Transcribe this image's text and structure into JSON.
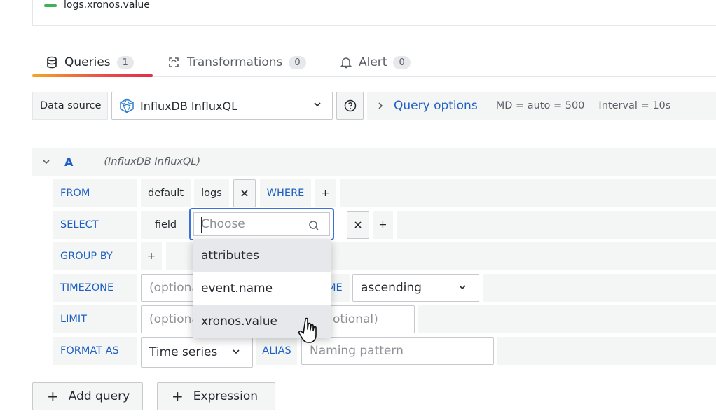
{
  "legend": {
    "label": "logs.xronos.value",
    "color": "#3eb15b"
  },
  "tabs": [
    {
      "label": "Queries",
      "count": "1",
      "icon": "database-icon"
    },
    {
      "label": "Transformations",
      "count": "0",
      "icon": "transform-icon"
    },
    {
      "label": "Alert",
      "count": "0",
      "icon": "bell-icon"
    }
  ],
  "datasource": {
    "label": "Data source",
    "selected": "InfluxDB InfluxQL",
    "query_options_label": "Query options",
    "md": "MD = auto = 500",
    "interval": "Interval = 10s"
  },
  "query": {
    "name": "A",
    "source": "(InfluxDB InfluxQL)"
  },
  "rows": {
    "from": {
      "label": "FROM",
      "policy": "default",
      "measurement": "logs",
      "where": "WHERE",
      "plus": "+",
      "remove": "×"
    },
    "select": {
      "label": "SELECT",
      "field": "field",
      "plus": "+",
      "remove": "×"
    },
    "groupby": {
      "label": "GROUP BY",
      "plus": "+"
    },
    "timezone": {
      "label": "TIMEZONE",
      "placeholder": "(optiona",
      "order_label_partial": "ME",
      "order_value": "ascending"
    },
    "limit": {
      "label": "LIMIT",
      "placeholder": "(optiona",
      "slimit_placeholder": "otional)"
    },
    "format": {
      "label": "FORMAT AS",
      "value": "Time series",
      "alias_label": "ALIAS",
      "alias_placeholder": "Naming pattern"
    }
  },
  "field_picker": {
    "placeholder": "Choose",
    "options": [
      "attributes",
      "event.name",
      "xronos.value"
    ]
  },
  "buttons": {
    "add_query": "Add query",
    "expression": "Expression"
  },
  "colors": {
    "accent_blue": "#1f60c4",
    "focus_blue": "#3d71d9"
  }
}
